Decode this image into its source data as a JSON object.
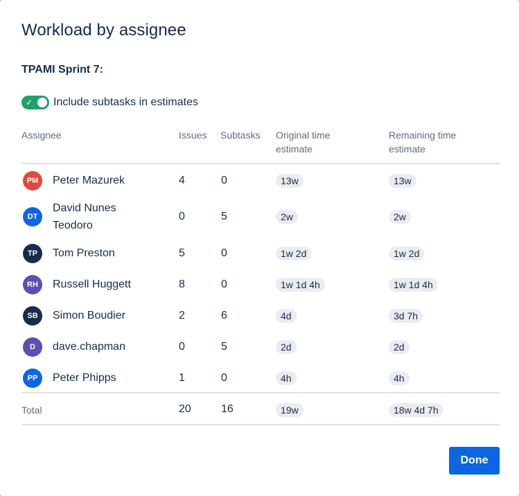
{
  "dialog": {
    "title": "Workload by assignee",
    "sprint_label": "TPAMI Sprint 7:",
    "toggle": {
      "label": "Include subtasks in estimates",
      "checked": true,
      "check_glyph": "✓"
    },
    "done_label": "Done"
  },
  "colors": {
    "primary": "#0c66e4",
    "toggle_on": "#22a06b",
    "text": "#172b4d",
    "subtle_text": "#5e6c84",
    "lozenge_bg": "#ebecf0"
  },
  "table": {
    "headers": {
      "assignee": "Assignee",
      "issues": "Issues",
      "subtasks": "Subtasks",
      "original_line1": "Original time",
      "original_line2": "estimate",
      "remaining_line1": "Remaining time",
      "remaining_line2": "estimate"
    },
    "rows": [
      {
        "initials": "PM",
        "avatar_color": "#e2483d",
        "name_line1": "Peter Mazurek",
        "name_line2": "",
        "issues": "4",
        "subtasks": "0",
        "original": "13w",
        "remaining": "13w"
      },
      {
        "initials": "DT",
        "avatar_color": "#0c66e4",
        "name_line1": "David Nunes",
        "name_line2": "Teodoro",
        "issues": "0",
        "subtasks": "5",
        "original": "2w",
        "remaining": "2w"
      },
      {
        "initials": "TP",
        "avatar_color": "#172b4d",
        "name_line1": "Tom Preston",
        "name_line2": "",
        "issues": "5",
        "subtasks": "0",
        "original": "1w 2d",
        "remaining": "1w 2d"
      },
      {
        "initials": "RH",
        "avatar_color": "#5e4db2",
        "name_line1": "Russell Huggett",
        "name_line2": "",
        "issues": "8",
        "subtasks": "0",
        "original": "1w 1d 4h",
        "remaining": "1w 1d 4h"
      },
      {
        "initials": "SB",
        "avatar_color": "#172b4d",
        "name_line1": "Simon Boudier",
        "name_line2": "",
        "issues": "2",
        "subtasks": "6",
        "original": "4d",
        "remaining": "3d 7h"
      },
      {
        "initials": "D",
        "avatar_color": "#5e4db2",
        "name_line1": "dave.chapman",
        "name_line2": "",
        "issues": "0",
        "subtasks": "5",
        "original": "2d",
        "remaining": "2d"
      },
      {
        "initials": "PP",
        "avatar_color": "#0c66e4",
        "name_line1": "Peter Phipps",
        "name_line2": "",
        "issues": "1",
        "subtasks": "0",
        "original": "4h",
        "remaining": "4h"
      }
    ],
    "total": {
      "label": "Total",
      "issues": "20",
      "subtasks": "16",
      "original": "19w",
      "remaining": "18w 4d 7h"
    }
  }
}
